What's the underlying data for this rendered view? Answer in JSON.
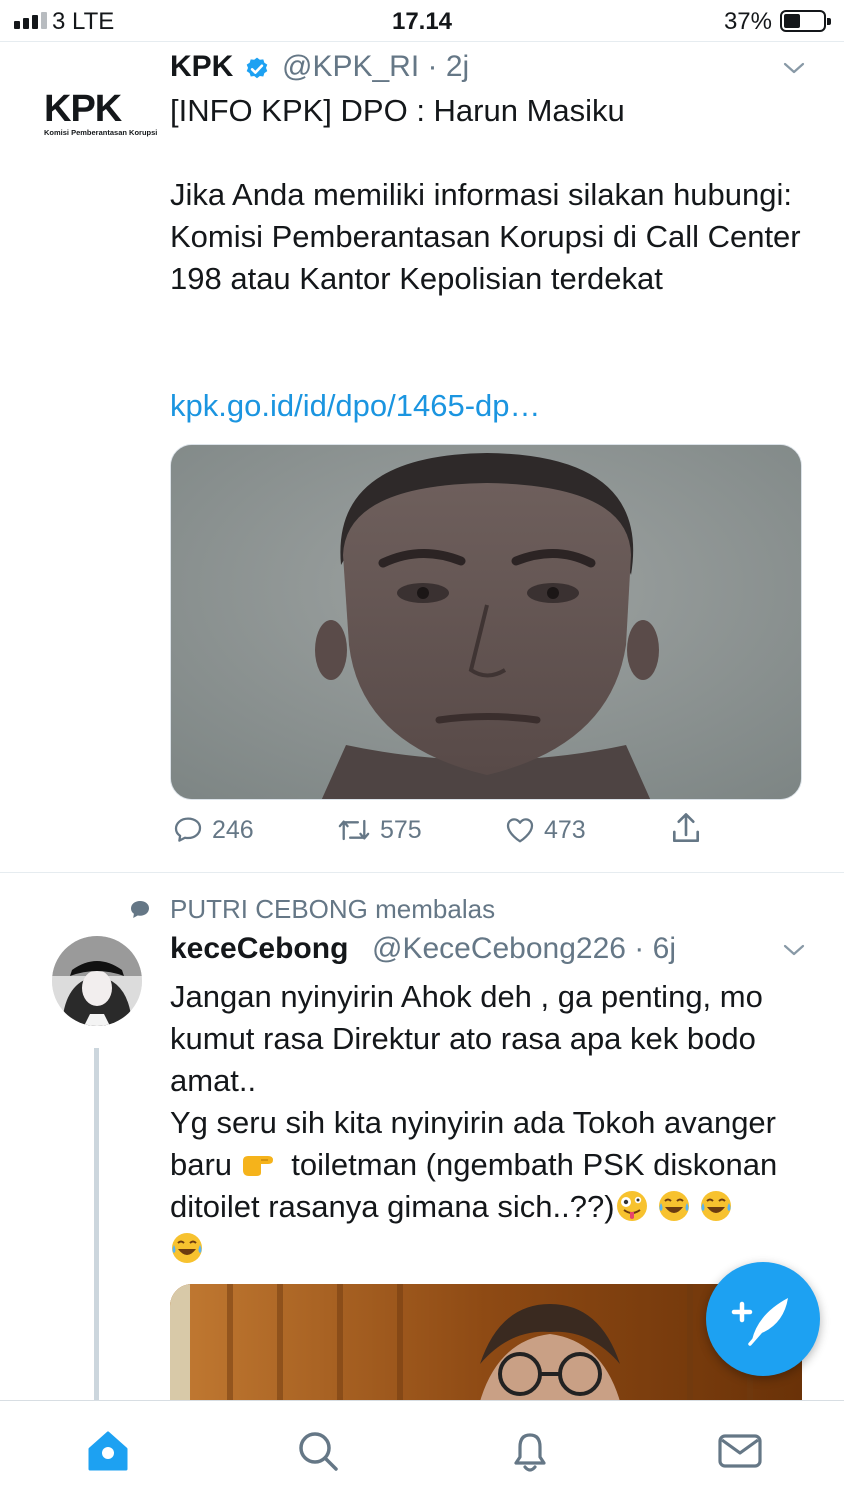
{
  "status_bar": {
    "carrier": "3  LTE",
    "time": "17.14",
    "battery": "37%"
  },
  "tweet1": {
    "logo_big": "KPK",
    "logo_small": "Komisi Pemberantasan Korupsi",
    "name": "KPK",
    "handle": "@KPK_RI · 2j",
    "text_line1": "[INFO KPK] DPO  : Harun Masiku",
    "text_para": "Jika Anda memiliki informasi silakan hubungi:\nKomisi Pemberantasan Korupsi di Call Center 198 atau Kantor Kepolisian terdekat",
    "link": "kpk.go.id/id/dpo/1465-dp…",
    "replies": "246",
    "retweets": "575",
    "likes": "473"
  },
  "tweet2": {
    "reply_context": "PUTRI CEBONG membalas",
    "name": "keceCebong",
    "handle": "@KeceCebong226 · 6j",
    "text_main": "Jangan nyinyirin Ahok deh , ga penting, mo kumut rasa Direktur ato rasa apa kek bodo amat..\nYg seru sih kita nyinyirin ada Tokoh avanger baru ",
    "text_after_point": " toiletman (ngembath PSK diskonan ditoilet rasanya gimana sich..??)"
  },
  "tabs": [
    "home-icon",
    "search-icon",
    "notifications-icon",
    "messages-icon"
  ],
  "colors": {
    "accent": "#1da1f2",
    "link": "#1b95e0",
    "muted": "#657786"
  }
}
